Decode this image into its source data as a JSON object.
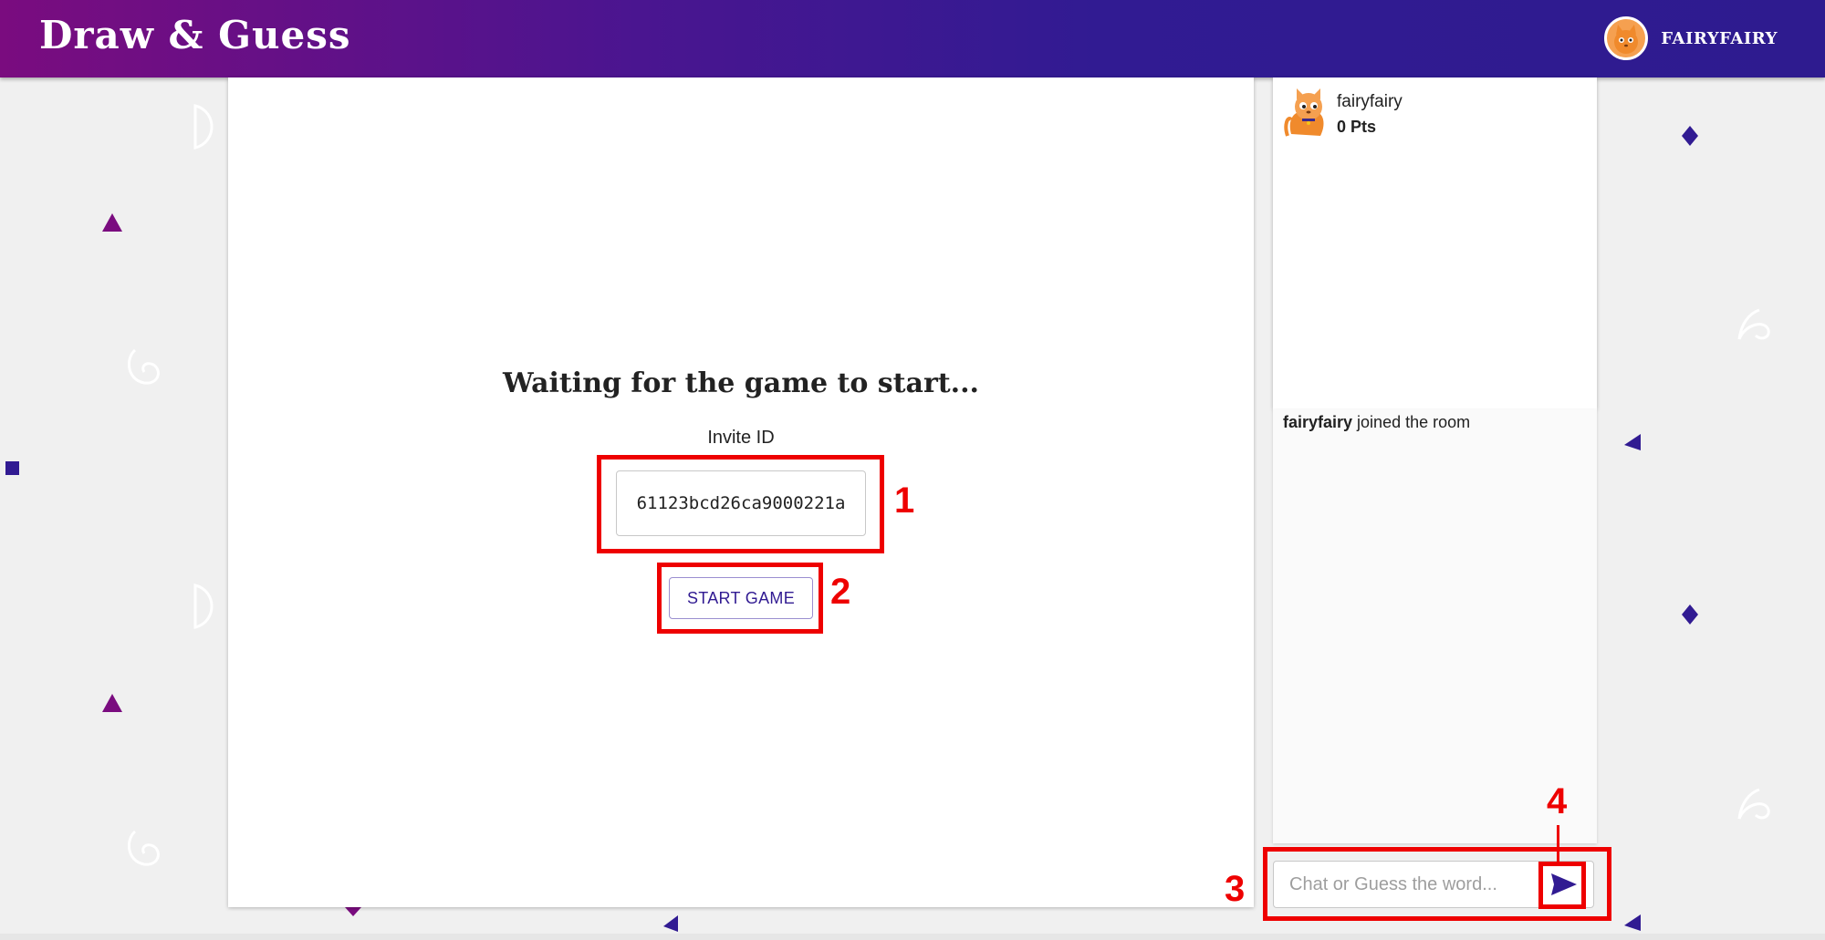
{
  "header": {
    "brand": "Draw & Guess",
    "username": "FAIRYFAIRY"
  },
  "lobby": {
    "waiting_title": "Waiting for the game to start...",
    "invite_label": "Invite ID",
    "invite_id": "61123bcd26ca9000221a",
    "start_button": "START GAME"
  },
  "players": [
    {
      "name": "fairyfairy",
      "points": "0 Pts"
    }
  ],
  "chat": {
    "messages": [
      {
        "user": "fairyfairy",
        "text": " joined the room"
      }
    ],
    "input_placeholder": "Chat or Guess the word..."
  },
  "annotations": [
    "1",
    "2",
    "3",
    "4"
  ],
  "colors": {
    "header_start": "#7a0c7f",
    "header_end": "#2e1b8f",
    "accent": "#311b92",
    "highlight": "#ee0000",
    "avatar_orange": "#f5a050"
  }
}
